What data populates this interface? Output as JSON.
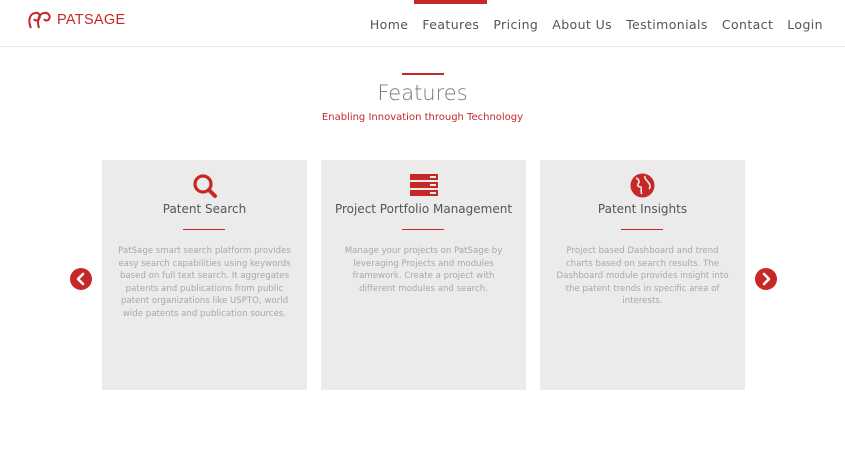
{
  "brand": {
    "name": "PATSAGE",
    "logo_icon": "patsage-logo-icon",
    "color": "#c62828"
  },
  "nav": {
    "items": [
      {
        "label": "Home"
      },
      {
        "label": "Features",
        "active": true
      },
      {
        "label": "Pricing"
      },
      {
        "label": "About Us"
      },
      {
        "label": "Testimonials"
      },
      {
        "label": "Contact"
      },
      {
        "label": "Login"
      }
    ]
  },
  "section": {
    "title": "Features",
    "subtitle": "Enabling Innovation through Technology"
  },
  "cards": [
    {
      "icon": "search-icon",
      "title": "Patent Search",
      "text": "PatSage smart search platform provides easy search capabilities using keywords based on full text search. It aggregates patents and publications from public patent organizations like USPTO, world wide patents and publication sources."
    },
    {
      "icon": "server-icon",
      "title": "Project Portfolio Management",
      "text": "Manage your projects on PatSage by leveraging Projects and modules framework. Create a project with different modules and search."
    },
    {
      "icon": "globe-icon",
      "title": "Patent Insights",
      "text": "Project based Dashboard and trend charts based on search results. The Dashboard module provides insight into the patent trends in specific area of interests."
    }
  ],
  "carousel": {
    "prev_icon": "chevron-left-circle-icon",
    "next_icon": "chevron-right-circle-icon"
  },
  "colors": {
    "accent": "#c62828",
    "card_bg": "#ebebeb",
    "text_muted": "#a8a8a8"
  }
}
